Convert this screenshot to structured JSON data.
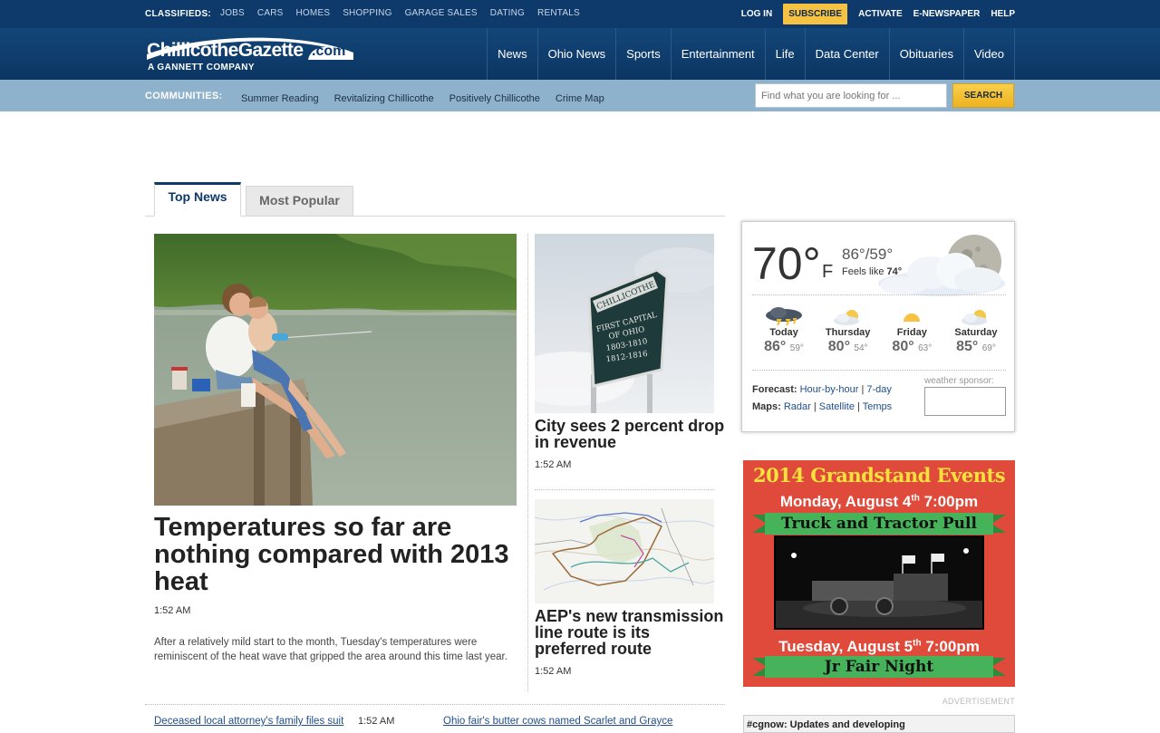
{
  "topbar": {
    "classifieds_label": "CLASSIFIEDS:",
    "classified_links": [
      "JOBS",
      "CARS",
      "HOMES",
      "SHOPPING",
      "GARAGE SALES",
      "DATING",
      "RENTALS"
    ],
    "login": "LOG IN",
    "subscribe": "SUBSCRIBE",
    "activate": "ACTIVATE",
    "enewspaper": "E-NEWSPAPER",
    "help": "HELP"
  },
  "logo": {
    "name": "ChillicotheGazette",
    "dotcom": ".com",
    "tagline": "A GANNETT COMPANY"
  },
  "nav": [
    "News",
    "Ohio News",
    "Sports",
    "Entertainment",
    "Life",
    "Data Center",
    "Obituaries",
    "Video"
  ],
  "communities": {
    "label": "COMMUNITIES:",
    "links": [
      "Summer Reading",
      "Revitalizing Chillicothe",
      "Positively Chillicothe",
      "Crime Map"
    ]
  },
  "search": {
    "placeholder": "Find what you are looking for ...",
    "button": "SEARCH"
  },
  "tabs": {
    "top_news": "Top News",
    "most_popular": "Most Popular"
  },
  "main_story": {
    "title": "Temperatures so far are nothing compared with 2013 heat",
    "time": "1:52 AM",
    "summary": "After a relatively mild start to the month, Tuesday's temperatures were reminiscent of the heat wave that gripped the area around this time last year."
  },
  "side_stories": [
    {
      "title": "City sees 2 percent drop in revenue",
      "time": "1:52 AM",
      "sign_text": [
        "CHILLICOTHE",
        "FIRST CAPITAL",
        "OF OHIO",
        "1803-1810",
        "1812-1816"
      ]
    },
    {
      "title": "AEP's new transmission line route is its preferred route",
      "time": "1:52 AM"
    }
  ],
  "more_stories": [
    {
      "title": "Deceased local attorney's family files suit",
      "time": "1:52 AM"
    },
    {
      "title": "Ohio fair's butter cows named Scarlet and Grayce"
    }
  ],
  "weather": {
    "temp": "70°",
    "unit": "F",
    "hilo": "86°/59°",
    "feels_label": "Feels like ",
    "feels_value": "74°",
    "days": [
      {
        "name": "Today",
        "hi": "86°",
        "lo": "59°",
        "icon": "thunderstorm-icon"
      },
      {
        "name": "Thursday",
        "hi": "80°",
        "lo": "54°",
        "icon": "partly-cloudy-icon"
      },
      {
        "name": "Friday",
        "hi": "80°",
        "lo": "63°",
        "icon": "sunny-icon"
      },
      {
        "name": "Saturday",
        "hi": "85°",
        "lo": "69°",
        "icon": "partly-cloudy-icon"
      }
    ],
    "forecast_label": "Forecast:",
    "forecast_links": [
      "Hour-by-hour",
      "7-day"
    ],
    "maps_label": "Maps:",
    "maps_links": [
      "Radar",
      "Satellite",
      "Temps"
    ],
    "sponsor_label": "weather sponsor:"
  },
  "ad": {
    "title": "2014 Grandstand Events",
    "date1_day": "Monday, August 4",
    "date1_sup": "th",
    "date1_time": " 7:00pm",
    "event1": "Truck and Tractor Pull",
    "date2_day": "Tuesday, August 5",
    "date2_sup": "th",
    "date2_time": " 7:00pm",
    "event2": "Jr Fair Night",
    "label": "ADVERTISEMENT"
  },
  "next_box": "#cgnow: Updates and developing",
  "colors": {
    "brand_blue": "#0d3a6b",
    "subscribe_yellow": "#f5c242",
    "community_bar": "#8eb1cc",
    "ad_red": "#e04a3a"
  }
}
